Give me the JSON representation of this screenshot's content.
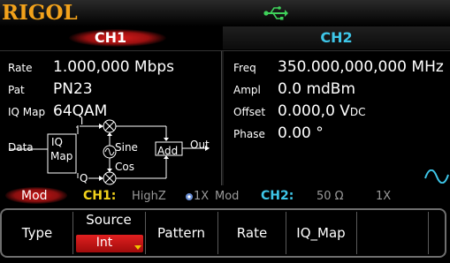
{
  "header": {
    "brand": "RIGOL",
    "usb_icon": "usb-icon",
    "usb_color": "#3fd15a"
  },
  "tabs": {
    "ch1": "CH1",
    "ch2": "CH2",
    "ch1_color": "#d81a1a",
    "ch2_color": "#3ec6e8"
  },
  "ch1_params": [
    {
      "label": "Rate",
      "value": "1.000,000 Mbps"
    },
    {
      "label": "Pat",
      "value": "PN23"
    },
    {
      "label": "IQ Map",
      "value": "64QAM"
    }
  ],
  "ch2_params": [
    {
      "label": "Freq",
      "value": "350.000,000,000 MHz"
    },
    {
      "label": "Ampl",
      "value": "0.0 mdBm"
    },
    {
      "label": "Offset",
      "value": "0.000,0 V",
      "sub": "DC"
    },
    {
      "label": "Phase",
      "value": "0.00 °"
    }
  ],
  "diagram": {
    "data": "Data",
    "iq_line1": "IQ",
    "iq_line2": "Map",
    "i": "I",
    "q": "Q",
    "sine": "Sine",
    "cos": "Cos",
    "add": "Add",
    "out": "Out"
  },
  "status": {
    "mode": "Mod",
    "ch1": "CH1:",
    "ch1_imp": "HighZ",
    "ch1_atten": "1X",
    "ch1_mod": "Mod",
    "ch2": "CH2:",
    "ch2_imp": "50 Ω",
    "ch2_atten": "1X",
    "ch1_color": "#f2d21b",
    "ch2_color": "#3ec6e8"
  },
  "softkeys": {
    "type": "Type",
    "source_label": "Source",
    "source_value": "Int",
    "pattern": "Pattern",
    "rate": "Rate",
    "iq_map": "IQ_Map"
  }
}
